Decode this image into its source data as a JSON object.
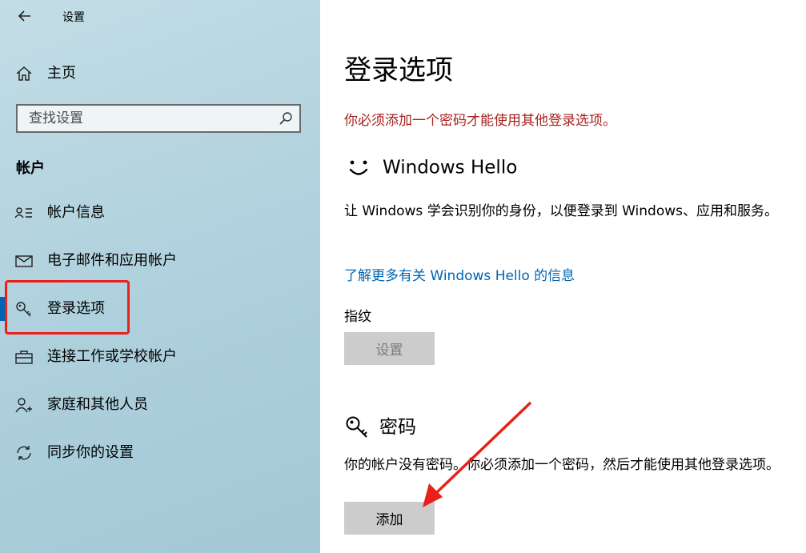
{
  "window": {
    "title": "设置",
    "back_icon": "back-arrow-icon"
  },
  "sidebar": {
    "home": {
      "label": "主页",
      "icon": "home-icon"
    },
    "search": {
      "placeholder": "查找设置",
      "icon": "search-icon"
    },
    "section_header": "帐户",
    "items": [
      {
        "label": "帐户信息",
        "icon": "person-list-icon"
      },
      {
        "label": "电子邮件和应用帐户",
        "icon": "mail-icon"
      },
      {
        "label": "登录选项",
        "icon": "key-icon",
        "selected": true
      },
      {
        "label": "连接工作或学校帐户",
        "icon": "briefcase-icon"
      },
      {
        "label": "家庭和其他人员",
        "icon": "person-add-icon"
      },
      {
        "label": "同步你的设置",
        "icon": "sync-icon"
      }
    ]
  },
  "main": {
    "title": "登录选项",
    "warning": "你必须添加一个密码才能使用其他登录选项。",
    "hello": {
      "title": "Windows Hello",
      "icon": "smiley-icon",
      "description": "让 Windows 学会识别你的身份，以便登录到 Windows、应用和服务。",
      "link": "了解更多有关 Windows Hello 的信息",
      "fingerprint_label": "指纹",
      "setup_button": "设置"
    },
    "password": {
      "title": "密码",
      "icon": "key-icon",
      "description": "你的帐户没有密码。你必须添加一个密码，然后才能使用其他登录选项。",
      "add_button": "添加"
    }
  },
  "colors": {
    "accent": "#0063b1",
    "warning": "#a8221e",
    "link": "#0065b3",
    "annotation": "#e8221b"
  }
}
